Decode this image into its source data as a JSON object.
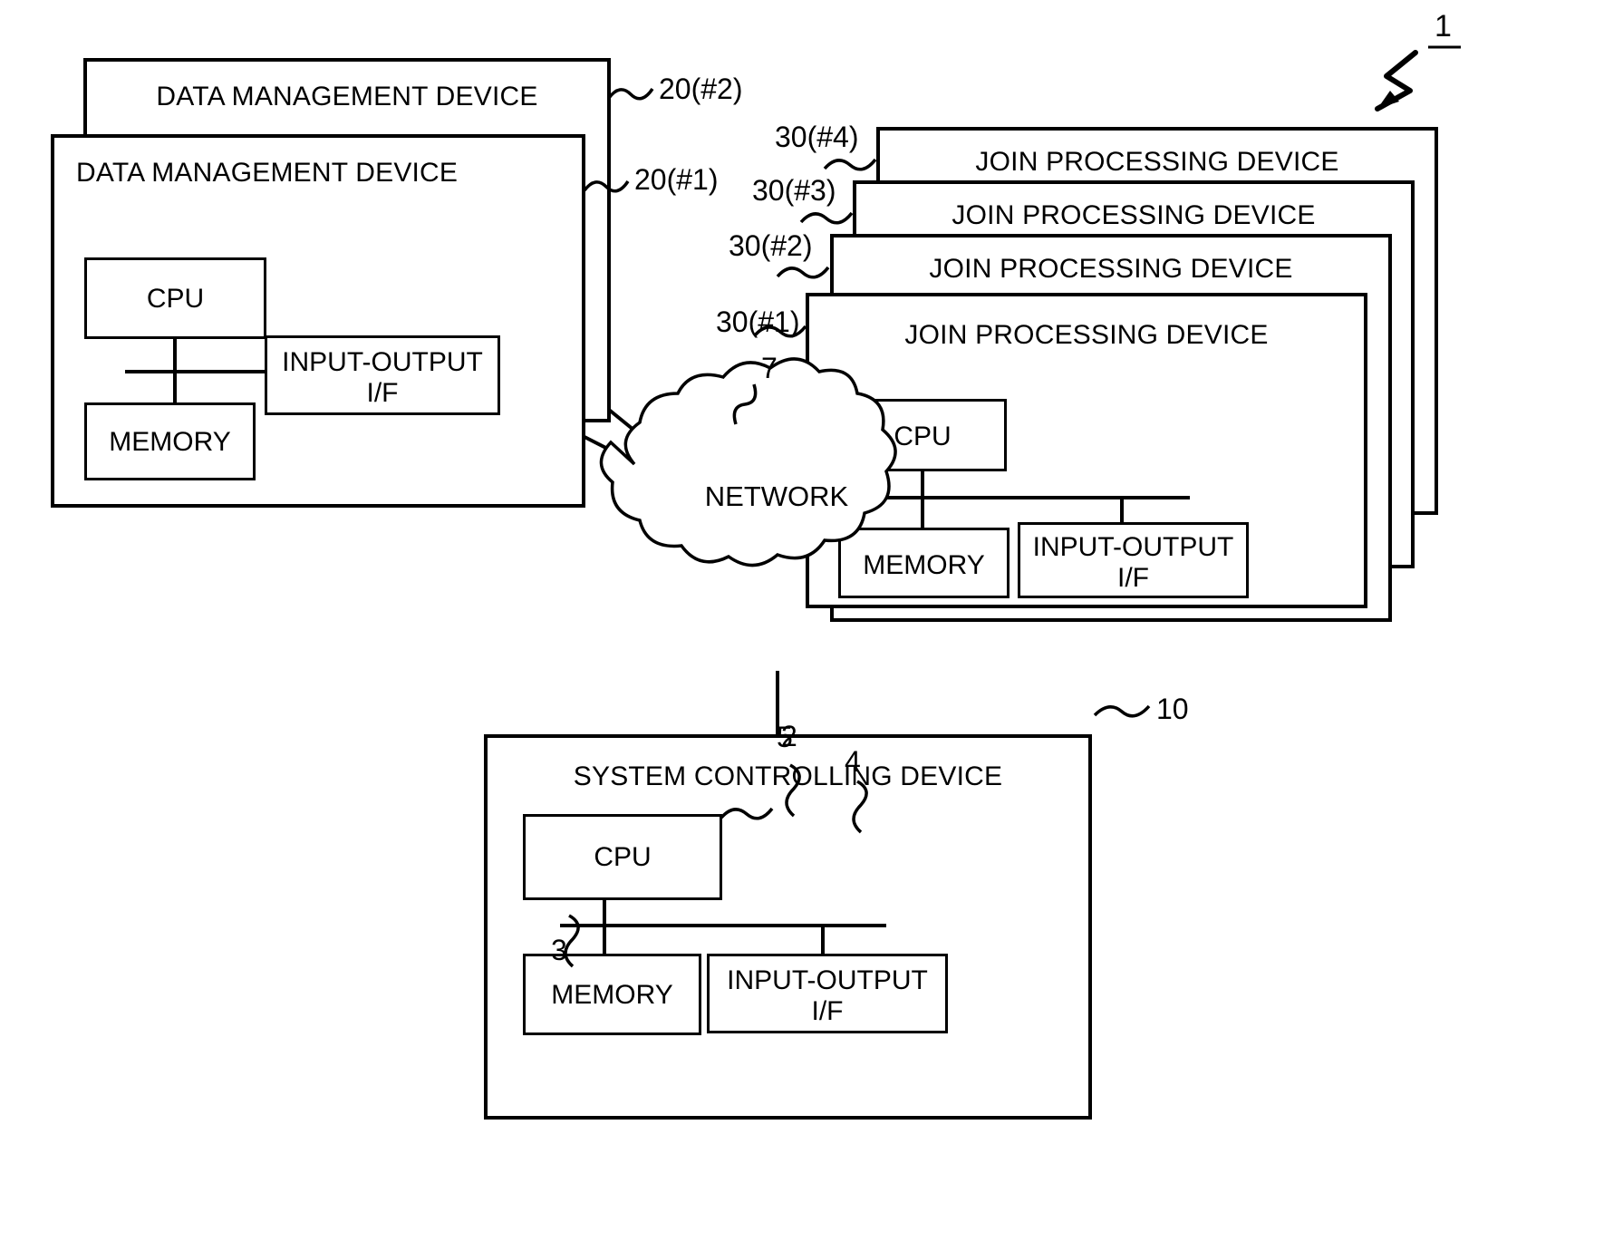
{
  "figure": {
    "system_ref": "1"
  },
  "data_management_devices": [
    {
      "title": "DATA MANAGEMENT DEVICE",
      "ref": "20(#2)"
    },
    {
      "title": "DATA MANAGEMENT DEVICE",
      "ref": "20(#1)"
    }
  ],
  "join_processing_devices": [
    {
      "title": "JOIN PROCESSING DEVICE",
      "ref": "30(#4)"
    },
    {
      "title": "JOIN PROCESSING DEVICE",
      "ref": "30(#3)"
    },
    {
      "title": "JOIN PROCESSING DEVICE",
      "ref": "30(#2)"
    },
    {
      "title": "JOIN PROCESSING DEVICE",
      "ref": "30(#1)"
    }
  ],
  "components": {
    "cpu": "CPU",
    "memory": "MEMORY",
    "io_line1": "INPUT-OUTPUT",
    "io_line2": "I/F",
    "io_full": "INPUT-OUTPUT\nI/F"
  },
  "network": {
    "label": "NETWORK",
    "ref": "7"
  },
  "system_controlling_device": {
    "title": "SYSTEM CONTROLLING DEVICE",
    "ref": "10",
    "cpu_ref": "2",
    "memory_ref": "3",
    "bus_ref": "5",
    "io_ref": "4"
  }
}
